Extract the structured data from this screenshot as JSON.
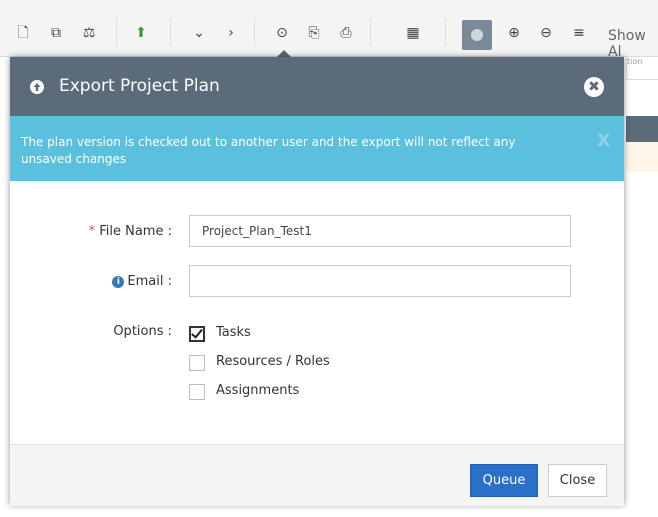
{
  "toolbar": {
    "show_all_label": "Show Al",
    "tools": [
      "new-doc-icon",
      "copy-icon",
      "balance-icon",
      "upload-icon",
      "chevron-down-icon",
      "chevron-right-icon",
      "export-icon",
      "download-icon",
      "print-icon",
      "calculator-icon",
      "toggle-icon",
      "zoom-in-icon",
      "zoom-out-icon",
      "align-icon"
    ],
    "background_column_header": "tion"
  },
  "modal": {
    "title": "Export Project Plan",
    "alert_text": "The plan version is checked out to another user and the export will not reflect any unsaved changes",
    "alert_close": "X",
    "fields": {
      "file_name_label": "File Name :",
      "file_name_required_mark": "*",
      "file_name_value": "Project_Plan_Test1",
      "email_label": "Email :",
      "email_value": "",
      "options_label": "Options :"
    },
    "options": [
      {
        "label": "Tasks",
        "checked": true
      },
      {
        "label": "Resources / Roles",
        "checked": false
      },
      {
        "label": "Assignments",
        "checked": false
      }
    ],
    "buttons": {
      "queue": "Queue",
      "close": "Close"
    }
  },
  "colors": {
    "header_bg": "#5b6b7a",
    "alert_bg": "#5bc0de",
    "primary_btn": "#2a6fc9",
    "required": "#d9534f"
  }
}
